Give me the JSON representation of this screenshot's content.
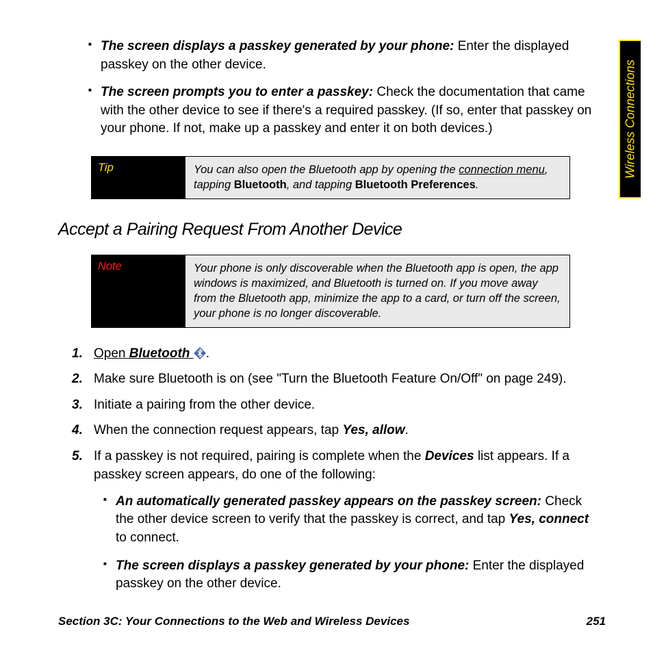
{
  "side_tab": "Wireless Connections",
  "top_bullets": [
    {
      "lead": "The screen displays a passkey generated by your phone:",
      "rest": " Enter the displayed passkey on the other device."
    },
    {
      "lead": "The screen prompts you to enter a passkey:",
      "rest": " Check the documentation that came with the other device to see if there's a required passkey. (If so, enter that passkey on your phone. If not, make up a passkey and enter it on both devices.)"
    }
  ],
  "tip": {
    "label": "Tip",
    "pre": "You can also open the Bluetooth app by opening the ",
    "link": "connection menu",
    "mid": ", tapping ",
    "b1": "Bluetooth",
    "mid2": ", and tapping ",
    "b2": "Bluetooth Preferences",
    "end": "."
  },
  "heading": "Accept a Pairing Request From Another Device",
  "note": {
    "label": "Note",
    "text": "Your phone is only discoverable when the Bluetooth app is open, the app windows is maximized, and Bluetooth is turned on. If you move away from the Bluetooth app, minimize the app to a card, or turn off the screen, your phone is no longer discoverable."
  },
  "steps": {
    "s1_open": "Open",
    "s1_bt": " Bluetooth ",
    "s1_end": ".",
    "s2": "Make sure Bluetooth is on (see \"Turn the Bluetooth Feature On/Off\" on page 249).",
    "s3": "Initiate a pairing from the other device.",
    "s4_pre": "When the connection request appears, tap ",
    "s4_bi": "Yes, allow",
    "s4_end": ".",
    "s5_pre": "If a passkey is not required, pairing is complete when the ",
    "s5_bi": "Devices",
    "s5_post": " list appears. If a passkey screen appears, do one of the following:",
    "s5_bullets": [
      {
        "lead": "An automatically generated passkey appears on the passkey screen:",
        "rest_pre": " Check the other device screen to verify that the passkey is correct, and tap ",
        "bi": "Yes, connect",
        "rest_post": " to connect."
      },
      {
        "lead": "The screen displays a passkey generated by your phone:",
        "rest_pre": " Enter the displayed passkey on the other device.",
        "bi": "",
        "rest_post": ""
      }
    ]
  },
  "footer": {
    "section": "Section 3C: Your Connections to the Web and Wireless Devices",
    "page": "251"
  }
}
